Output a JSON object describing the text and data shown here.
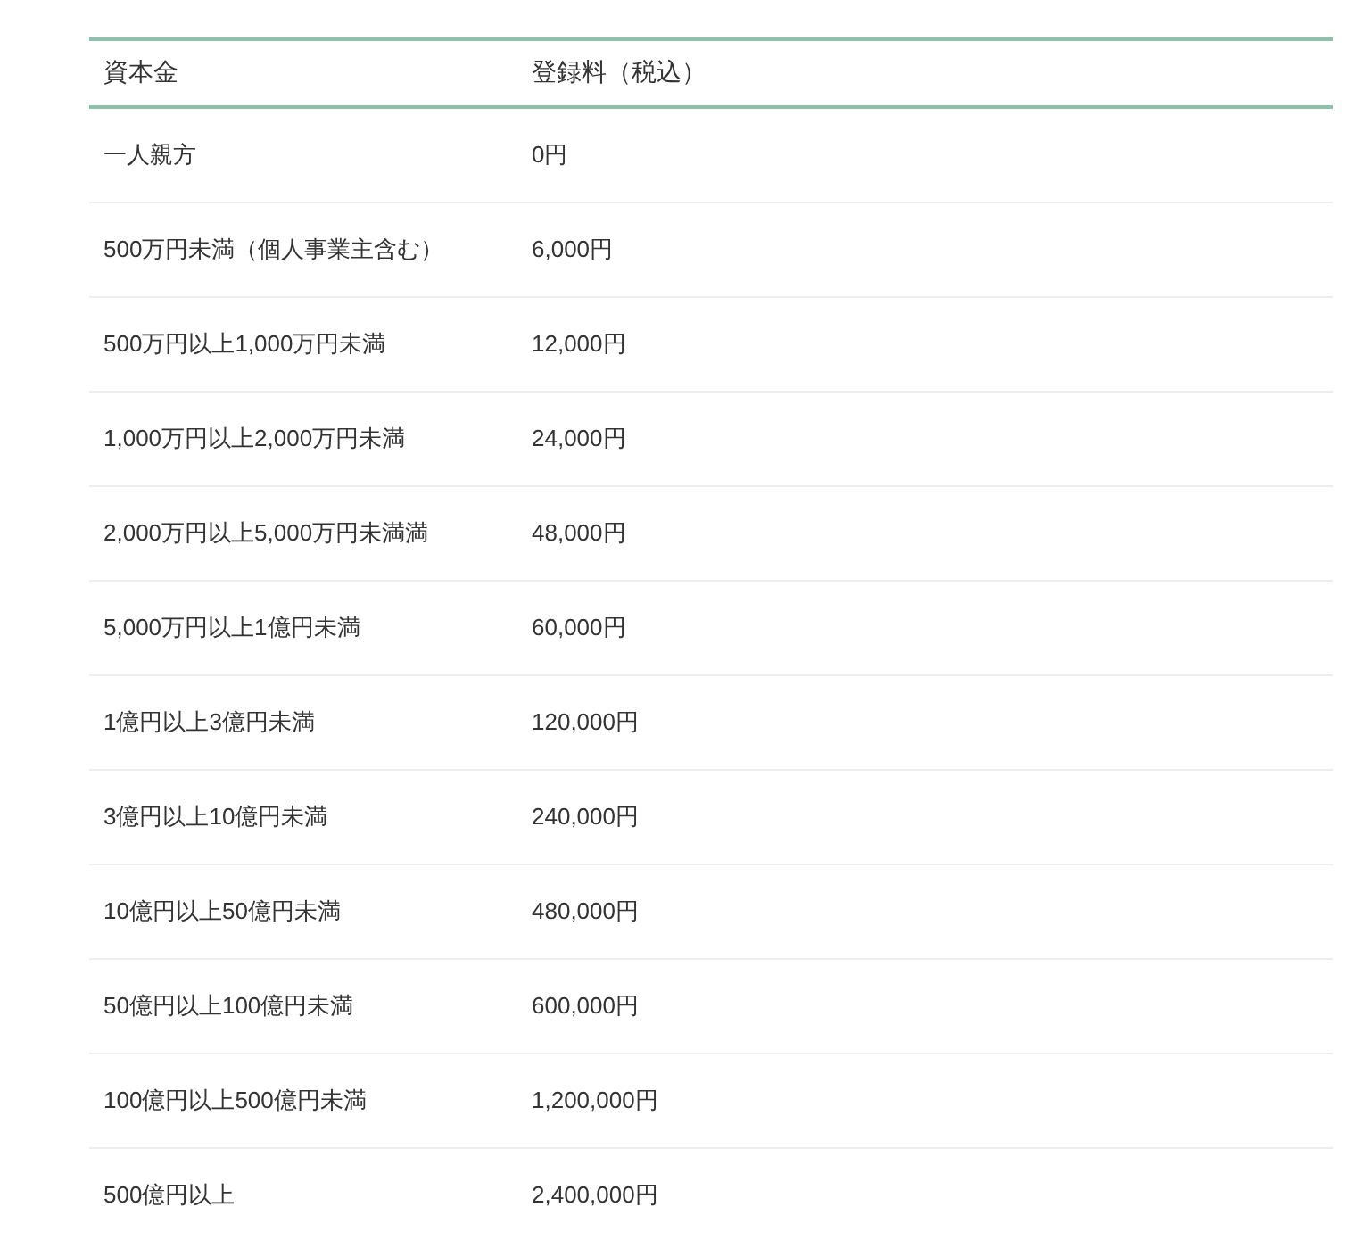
{
  "table": {
    "columns": [
      "資本金",
      "登録料（税込）"
    ],
    "rows": [
      [
        "一人親方",
        "0円"
      ],
      [
        "500万円未満（個人事業主含む）",
        "6,000円"
      ],
      [
        "500万円以上1,000万円未満",
        "12,000円"
      ],
      [
        "1,000万円以上2,000万円未満",
        "24,000円"
      ],
      [
        "2,000万円以上5,000万円未満満",
        "48,000円"
      ],
      [
        "5,000万円以上1億円未満",
        "60,000円"
      ],
      [
        "1億円以上3億円未満",
        "120,000円"
      ],
      [
        "3億円以上10億円未満",
        "240,000円"
      ],
      [
        "10億円以上50億円未満",
        "480,000円"
      ],
      [
        "50億円以上100億円未満",
        "600,000円"
      ],
      [
        "100億円以上500億円未満",
        "1,200,000円"
      ],
      [
        "500億円以上",
        "2,400,000円"
      ]
    ]
  }
}
